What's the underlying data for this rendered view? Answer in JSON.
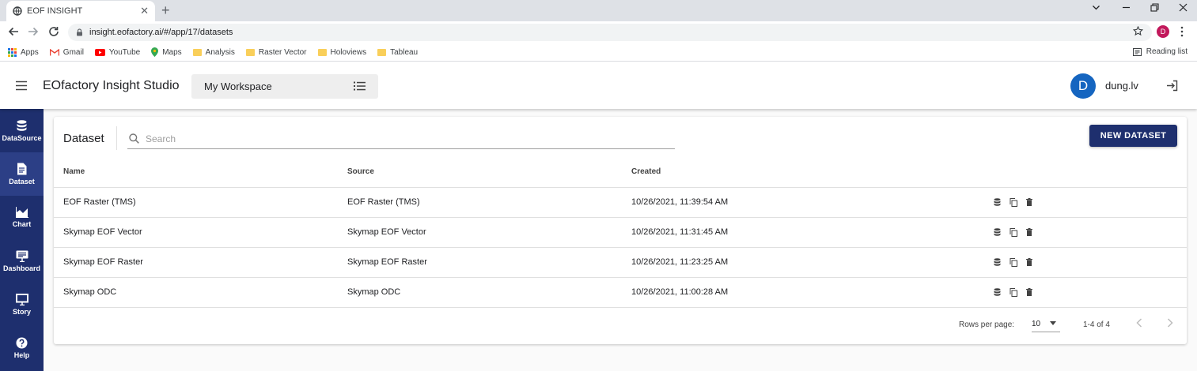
{
  "browser": {
    "tab_title": "EOF INSIGHT",
    "url": "insight.eofactory.ai/#/app/17/datasets",
    "profile_initial": "D",
    "bookmarks": [
      {
        "label": "Apps",
        "icon": "apps-grid-icon"
      },
      {
        "label": "Gmail",
        "icon": "gmail-icon"
      },
      {
        "label": "YouTube",
        "icon": "youtube-icon"
      },
      {
        "label": "Maps",
        "icon": "maps-pin-icon"
      },
      {
        "label": "Analysis",
        "icon": "folder-icon"
      },
      {
        "label": "Raster Vector",
        "icon": "folder-icon"
      },
      {
        "label": "Holoviews",
        "icon": "folder-icon"
      },
      {
        "label": "Tableau",
        "icon": "folder-icon"
      }
    ],
    "reading_list": "Reading list"
  },
  "header": {
    "app_title": "EOfactory Insight Studio",
    "workspace": "My Workspace",
    "avatar_initial": "D",
    "username": "dung.lv"
  },
  "sidebar": {
    "items": [
      {
        "label": "DataSource",
        "icon": "database-icon",
        "active": false
      },
      {
        "label": "Dataset",
        "icon": "document-icon",
        "active": true
      },
      {
        "label": "Chart",
        "icon": "area-chart-icon",
        "active": false
      },
      {
        "label": "Dashboard",
        "icon": "monitor-dashboard-icon",
        "active": false
      },
      {
        "label": "Story",
        "icon": "presentation-icon",
        "active": false
      },
      {
        "label": "Help",
        "icon": "help-icon",
        "active": false
      }
    ]
  },
  "main": {
    "title": "Dataset",
    "search_placeholder": "Search",
    "new_button": "NEW DATASET",
    "columns": [
      "Name",
      "Source",
      "Created"
    ],
    "rows": [
      {
        "name": "EOF Raster (TMS)",
        "source": "EOF Raster (TMS)",
        "created": "10/26/2021, 11:39:54 AM"
      },
      {
        "name": "Skymap EOF Vector",
        "source": "Skymap EOF Vector",
        "created": "10/26/2021, 11:31:45 AM"
      },
      {
        "name": "Skymap EOF Raster",
        "source": "Skymap EOF Raster",
        "created": "10/26/2021, 11:23:25 AM"
      },
      {
        "name": "Skymap ODC",
        "source": "Skymap ODC",
        "created": "10/26/2021, 11:00:28 AM"
      }
    ],
    "pagination": {
      "rows_per_page_label": "Rows per page:",
      "rows_per_page": "10",
      "range": "1-4 of 4"
    }
  },
  "colors": {
    "sidebar": "#1e2f6e",
    "sidebar_active": "#2c3f86",
    "primary_button": "#1e2f6e",
    "avatar": "#1565c0",
    "profile": "#c2185b"
  }
}
